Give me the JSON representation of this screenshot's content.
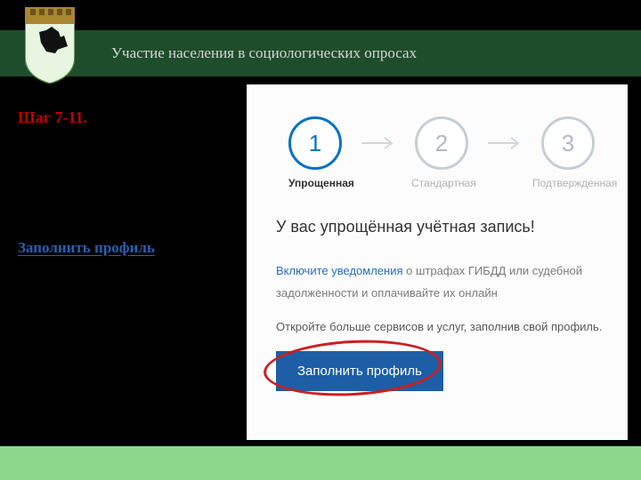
{
  "header": {
    "title": "Участие населения в социологических опросах"
  },
  "left": {
    "step_label": "Шаг 7-11.",
    "fill_profile_link": "Заполнить профиль"
  },
  "screenshot": {
    "steps": {
      "s1": {
        "num": "1",
        "label": "Упрощенная"
      },
      "s2": {
        "num": "2",
        "label": "Стандартная"
      },
      "s3": {
        "num": "3",
        "label": "Подтвержденная"
      }
    },
    "account_heading": "У вас упрощённая учётная запись!",
    "notify_link": "Включите уведомления",
    "notify_rest": " о штрафах ГИБДД или судебной задолженности и оплачивайте их онлайн",
    "open_more": "Откройте больше сервисов и услуг, заполнив свой профиль.",
    "fill_btn": "Заполнить профиль"
  }
}
